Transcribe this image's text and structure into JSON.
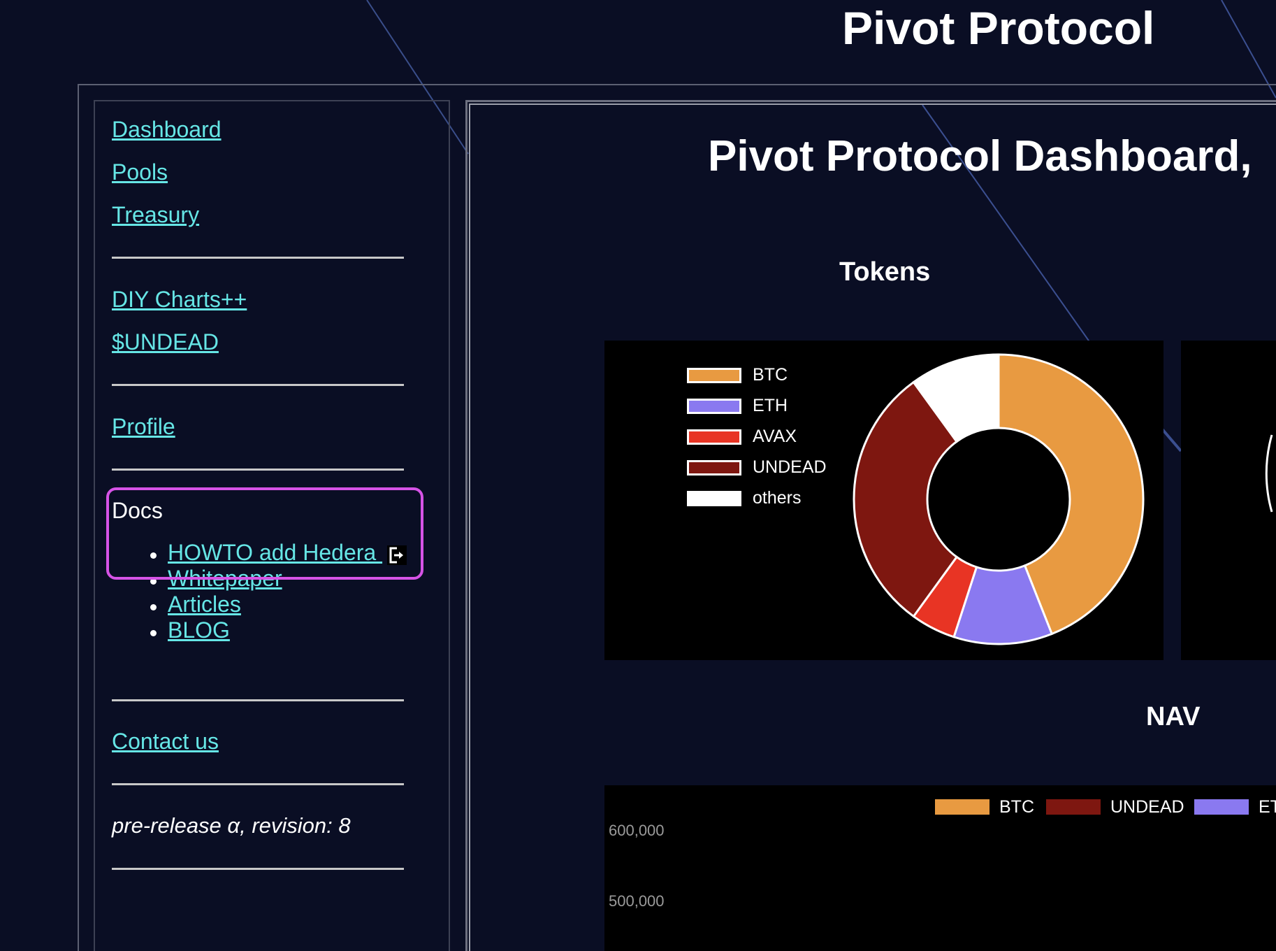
{
  "site": {
    "title": "Pivot Protocol"
  },
  "sidebar": {
    "links": [
      {
        "label": "Dashboard"
      },
      {
        "label": "Pools"
      },
      {
        "label": "Treasury"
      },
      {
        "label": "DIY Charts++"
      },
      {
        "label": "$UNDEAD"
      },
      {
        "label": "Profile"
      }
    ],
    "docs": {
      "title": "Docs",
      "items": [
        {
          "label": "HOWTO add Hedera "
        },
        {
          "label": "Whitepaper"
        },
        {
          "label": "Articles"
        },
        {
          "label": "BLOG"
        }
      ]
    },
    "contact": "Contact us",
    "version": "pre-release α, revision: 8"
  },
  "main": {
    "title": "Pivot Protocol Dashboard,",
    "tokens_title": "Tokens",
    "nav_title": "NAV"
  },
  "colors": {
    "btc": "#e89a41",
    "eth": "#8a79f0",
    "avax": "#e83424",
    "undead": "#7e1710",
    "others": "#ffffff",
    "link": "#66e6e6",
    "highlight": "#d653e6"
  },
  "chart_data": [
    {
      "type": "pie",
      "title": "Tokens",
      "legend_position": "left",
      "categories": [
        "BTC",
        "ETH",
        "AVAX",
        "UNDEAD",
        "others"
      ],
      "values": [
        44,
        11,
        5,
        30,
        10
      ],
      "colors": [
        "#e89a41",
        "#8a79f0",
        "#e83424",
        "#7e1710",
        "#ffffff"
      ]
    },
    {
      "type": "bar",
      "title": "NAV",
      "legend_position": "top",
      "legend": [
        "BTC",
        "UNDEAD",
        "ET"
      ],
      "legend_colors": [
        "#e89a41",
        "#7e1710",
        "#8a79f0"
      ],
      "y_ticks": [
        "600,000",
        "500,000"
      ]
    }
  ]
}
